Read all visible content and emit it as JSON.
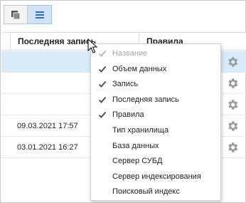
{
  "toolbar": {
    "buttons": [
      {
        "icon": "windows-stack-icon",
        "active": false
      },
      {
        "icon": "hamburger-menu-icon",
        "active": true
      }
    ]
  },
  "columns": [
    {
      "label": "Последняя запись"
    },
    {
      "label": "Правила"
    }
  ],
  "rows": [
    {
      "date": "",
      "selected": true
    },
    {
      "date": "",
      "selected": false
    },
    {
      "date": "",
      "selected": false
    },
    {
      "date": "09.03.2021 17:57",
      "selected": false
    },
    {
      "date": "03.01.2021 16:27",
      "selected": false
    }
  ],
  "menu": {
    "items": [
      {
        "label": "Название",
        "checked": true,
        "disabled": true
      },
      {
        "label": "Объем данных",
        "checked": true,
        "disabled": false
      },
      {
        "label": "Запись",
        "checked": true,
        "disabled": false
      },
      {
        "label": "Последняя запись",
        "checked": true,
        "disabled": false
      },
      {
        "label": "Правила",
        "checked": true,
        "disabled": false
      },
      {
        "label": "Тип хранилища",
        "checked": false,
        "disabled": false
      },
      {
        "label": "База данных",
        "checked": false,
        "disabled": false
      },
      {
        "label": "Сервер СУБД",
        "checked": false,
        "disabled": false
      },
      {
        "label": "Сервер индексирования",
        "checked": false,
        "disabled": false
      },
      {
        "label": "Поисковый индекс",
        "checked": false,
        "disabled": false
      }
    ]
  },
  "colors": {
    "accent": "#2f6fb5",
    "selected_row": "#d9ebf9",
    "gear": "#9a9a9a",
    "check": "#4a4a4a",
    "check_disabled": "#b5b5b5"
  }
}
